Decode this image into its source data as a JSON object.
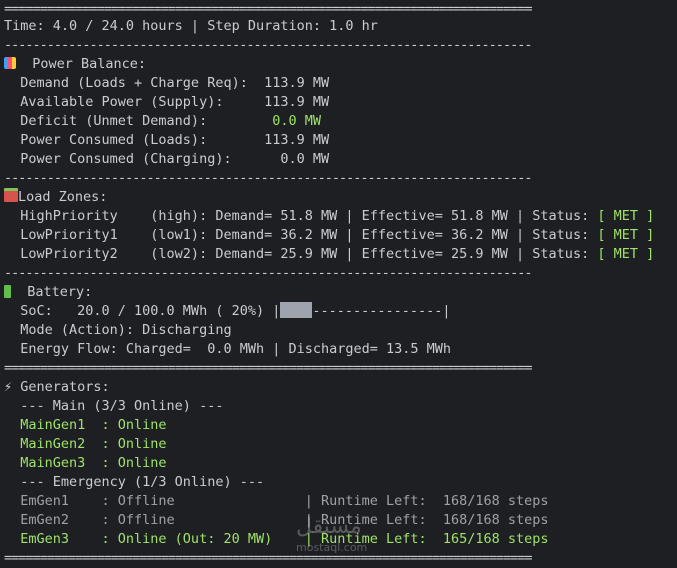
{
  "header": {
    "sep_double": "==========================================================================",
    "sep_single": "--------------------------------------------------------------------------",
    "time_line": "Time: 4.0 / 24.0 hours | Step Duration: 1.0 hr"
  },
  "power": {
    "title": "Power Balance:",
    "demand": "  Demand (Loads + Charge Req):  113.9 MW",
    "available": "  Available Power (Supply):     113.9 MW",
    "deficit_label": "  Deficit (Unmet Demand):       ",
    "deficit_value": " 0.0 MW",
    "consumed_loads": "  Power Consumed (Loads):       113.9 MW",
    "consumed_charging": "  Power Consumed (Charging):      0.0 MW"
  },
  "zones": {
    "title": "Load Zones:",
    "rows": [
      {
        "text": "  HighPriority    (high): Demand= 51.8 MW | Effective= 51.8 MW | Status: ",
        "status": "[ MET ]"
      },
      {
        "text": "  LowPriority1    (low1): Demand= 36.2 MW | Effective= 36.2 MW | Status: ",
        "status": "[ MET ]"
      },
      {
        "text": "  LowPriority2    (low2): Demand= 25.9 MW | Effective= 25.9 MW | Status: ",
        "status": "[ MET ]"
      }
    ]
  },
  "battery": {
    "title": "Battery:",
    "soc_prefix": "  SoC:   20.0 / 100.0 MWh ( 20%) |",
    "soc_suffix": "----------------|",
    "soc_fraction": 0.2,
    "mode": "  Mode (Action): Discharging",
    "flow": "  Energy Flow: Charged=  0.0 MWh | Discharged= 13.5 MWh"
  },
  "generators": {
    "title": " Generators:",
    "main_header": "  --- Main (3/3 Online) ---",
    "main": [
      {
        "name": "  MainGen1  : Online"
      },
      {
        "name": "  MainGen2  : Online"
      },
      {
        "name": "  MainGen3  : Online"
      }
    ],
    "emergency_header": "  --- Emergency (1/3 Online) ---",
    "emergency": [
      {
        "text": "  EmGen1    : Offline                | Runtime Left:  168/168 steps"
      },
      {
        "text": "  EmGen2    : Offline                | Runtime Left:  168/168 steps"
      },
      {
        "text": "  EmGen3    : Online (Out: 20 MW)    | Runtime Left:  165/168 steps"
      }
    ]
  },
  "watermark": {
    "arabic": "مستقل",
    "latin": "mostaql.com"
  }
}
